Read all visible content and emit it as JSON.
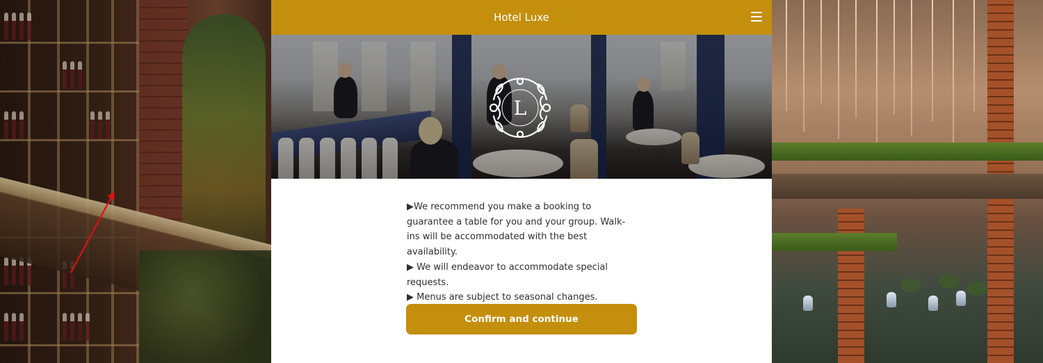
{
  "header": {
    "title": "Hotel Luxe",
    "menu_icon": "hamburger-menu-icon"
  },
  "hero": {
    "logo_letter": "L",
    "logo_icon": "ornamental-wreath-logo-icon"
  },
  "notes": [
    "▶We recommend you make a booking to guarantee a table for you and your group. Walk-ins will be accommodated with the best availability.",
    "▶ We will endeavor to accommodate special requests.",
    "▶ Menus are subject to seasonal changes."
  ],
  "actions": {
    "confirm_label": "Confirm and continue"
  },
  "colors": {
    "accent": "#c48f0d",
    "text": "#2e2e2e",
    "annotation_arrow": "#e01010"
  }
}
